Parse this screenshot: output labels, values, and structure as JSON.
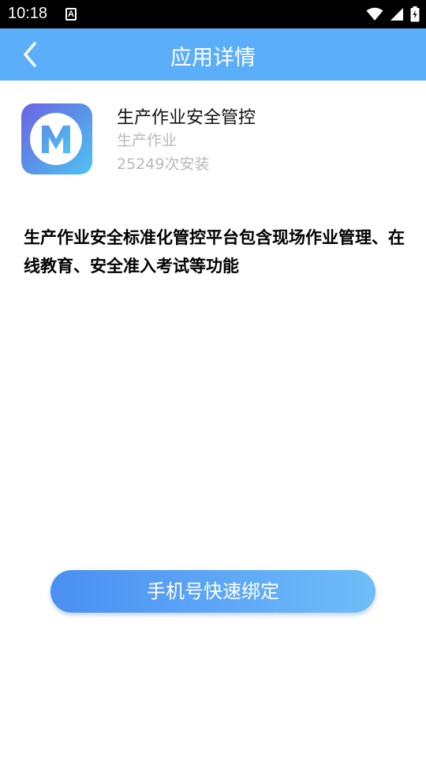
{
  "status_bar": {
    "time": "10:18",
    "notification_letter": "A"
  },
  "header": {
    "title": "应用详情",
    "back_icon": "chevron-left-icon",
    "background": "#5aaefa"
  },
  "app": {
    "icon_letter": "M",
    "name": "生产作业安全管控",
    "category": "生产作业",
    "installs": "25249次安装"
  },
  "description": "生产作业安全标准化管控平台包含现场作业管理、在线教育、安全准入考试等功能",
  "bind_button": {
    "label": "手机号快速绑定"
  },
  "colors": {
    "accent": "#5aaefa",
    "muted_text": "#b9b9b9",
    "button_start": "#4a8ff3",
    "button_end": "#6fbdf8"
  }
}
